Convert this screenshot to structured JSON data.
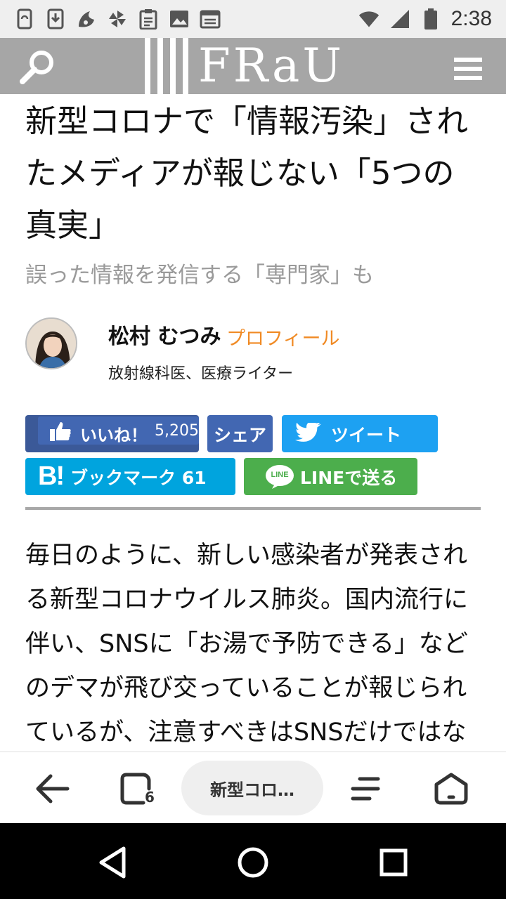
{
  "status_bar": {
    "time": "2:38",
    "left_icons": [
      "phone-sync-icon",
      "download-icon",
      "uc-browser-icon",
      "pinwheel-icon",
      "clipboard-icon",
      "image-icon",
      "calendar-icon"
    ],
    "right_icons": [
      "wifi-icon",
      "signal-icon",
      "battery-icon"
    ]
  },
  "header": {
    "logo": "FRaU",
    "search_icon": "search-icon",
    "menu_icon": "hamburger-menu-icon"
  },
  "article": {
    "title": "新型コロナで「情報汚染」されたメディアが報じない「5つの真実」",
    "subtitle": "誤った情報を発信する「専門家」も",
    "author": {
      "name": "松村 むつみ",
      "profile_link": "プロフィール",
      "role": "放射線科医、医療ライター"
    },
    "body": "毎日のように、新しい感染者が発表される新型コロナウイルス肺炎。国内流行に伴い、SNSに「お湯で予防できる」などのデマが飛び交っていることが報じられているが、注意すべきはSNSだけではな"
  },
  "share": {
    "like_label": "いいね！",
    "like_count": "5,205",
    "fb_share_label": "シェア",
    "tweet_label": "ツイート",
    "hatena_label": "ブックマーク 61",
    "line_label": "LINEで送る",
    "line_badge": "LINE"
  },
  "browser_toolbar": {
    "url_text": "新型コロ…",
    "tab_count": "6"
  },
  "colors": {
    "header_bg": "#a6a6a6",
    "facebook": "#3b5998",
    "twitter": "#1da1f2",
    "hatena": "#00a4de",
    "line": "#4cae4c",
    "profile_link": "#f08a24"
  }
}
